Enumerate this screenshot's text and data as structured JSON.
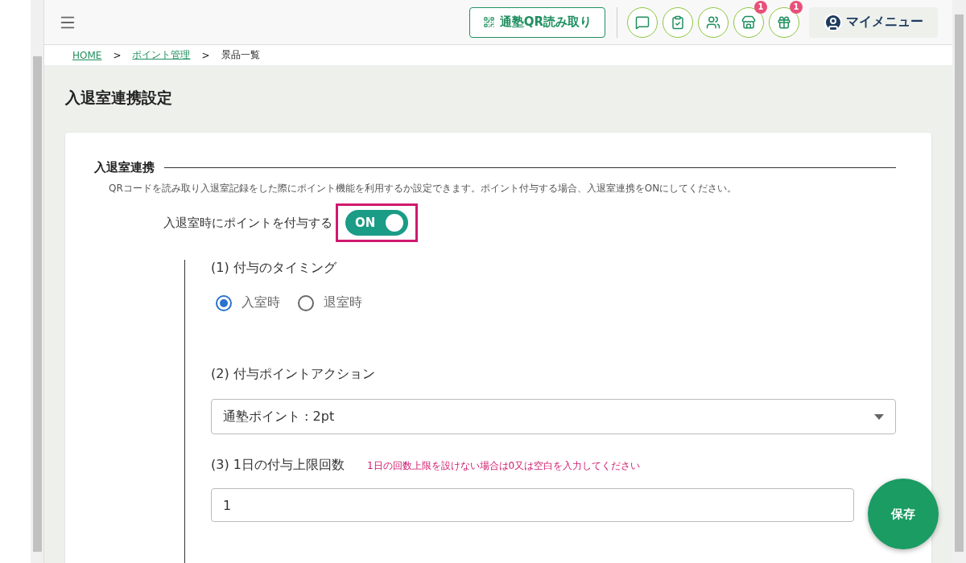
{
  "header": {
    "qr_button": {
      "label": "通塾QR読み取り"
    },
    "icon_buttons": [
      {
        "kind": "message"
      },
      {
        "kind": "checklist"
      },
      {
        "kind": "users"
      },
      {
        "kind": "store",
        "badge": "1"
      },
      {
        "kind": "gift",
        "badge": "1"
      }
    ],
    "my_menu": {
      "label": "マイメニュー"
    }
  },
  "breadcrumbs": [
    {
      "label": "HOME",
      "kind": "link"
    },
    {
      "label": ">",
      "kind": "separator"
    },
    {
      "label": "ポイント管理",
      "kind": "link"
    },
    {
      "label": ">",
      "kind": "separator"
    },
    {
      "label": "景品一覧",
      "kind": "current"
    }
  ],
  "page_title": "入退室連携設定",
  "section": {
    "heading": "入退室連携",
    "description": "QRコードを読み取り入退室記録をした際にポイント機能を利用するか設定できます。ポイント付与する場合、入退室連携をONにしてください。",
    "toggle": {
      "label": "入退室時にポイントを付与する",
      "on": true,
      "state_label": "ON"
    }
  },
  "steps": [
    {
      "kind": "radio",
      "label": "(1) 付与のタイミング",
      "options": [
        {
          "label": "入室時",
          "selected": true
        },
        {
          "label": "退室時",
          "selected": false
        }
      ]
    },
    {
      "kind": "select",
      "label": "(2) 付与ポイントアクション",
      "value": "通塾ポイント : 2pt"
    },
    {
      "kind": "input",
      "label": "(3) 1日の付与上限回数",
      "hint": "1日の回数上限を設けない場合は0又は空白を入力してください",
      "value": "1"
    }
  ],
  "save_button": {
    "label": "保存"
  }
}
